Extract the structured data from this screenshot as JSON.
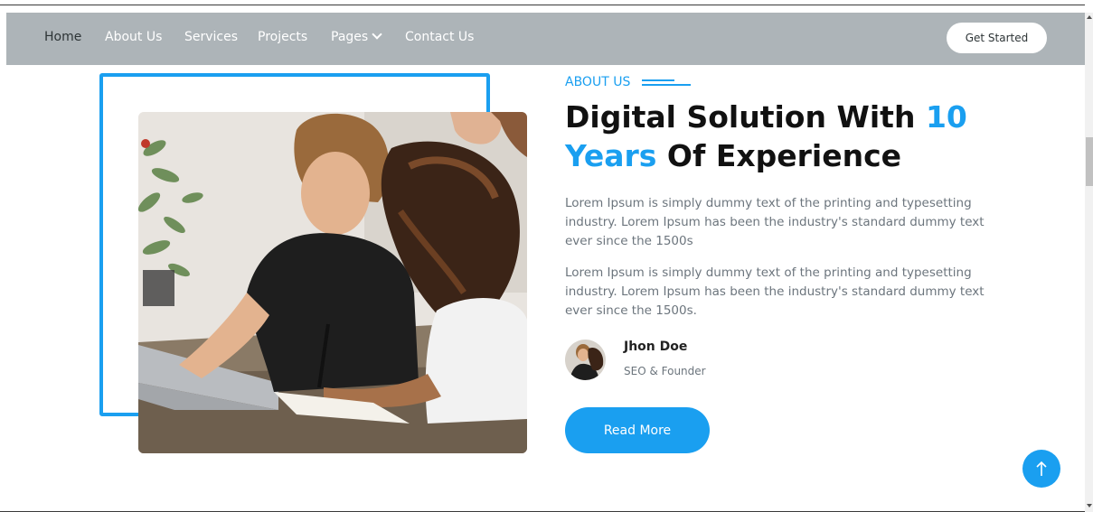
{
  "nav": {
    "items": [
      {
        "label": "Home"
      },
      {
        "label": "About Us"
      },
      {
        "label": "Services"
      },
      {
        "label": "Projects"
      },
      {
        "label": "Pages"
      },
      {
        "label": "Contact Us"
      }
    ],
    "cta_label": "Get Started"
  },
  "about": {
    "eyebrow": "ABOUT US",
    "headline_part1": "Digital Solution With ",
    "headline_accent1": "10",
    "headline_accent2": "Years",
    "headline_part2": " Of Experience",
    "paragraphs": [
      "Lorem Ipsum is simply dummy text of the printing and typesetting industry. Lorem Ipsum has been the industry's standard dummy text ever since the 1500s",
      "Lorem Ipsum is simply dummy text of the printing and typesetting industry. Lorem Ipsum has been the industry's standard dummy text ever since the 1500s."
    ],
    "author": {
      "name": "Jhon Doe",
      "role": "SEO & Founder"
    },
    "read_more_label": "Read More"
  },
  "colors": {
    "accent": "#1a9ff0",
    "navbar": "#adb4b8",
    "heading": "#111111",
    "body_text": "#6c757d"
  },
  "icons": {
    "dropdown": "chevron-down-icon",
    "back_to_top": "arrow-up-icon"
  }
}
